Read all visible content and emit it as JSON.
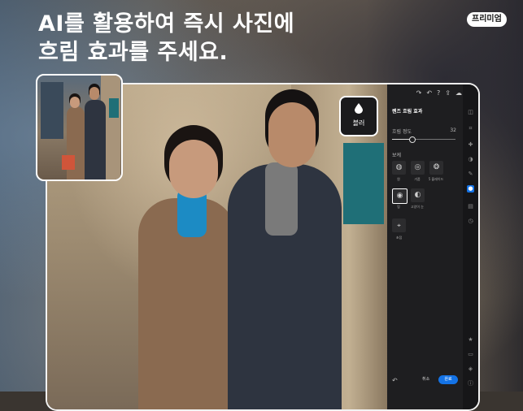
{
  "headline": {
    "line1": "AI를 활용하여 즉시 사진에",
    "line2": "흐림 효과를 주세요."
  },
  "badge": {
    "label": "프리미엄"
  },
  "canvas": {
    "blur_badge": {
      "icon": "water-drop-icon",
      "label": "블러"
    }
  },
  "panel": {
    "top_icons": [
      "redo-icon",
      "undo-icon",
      "help-icon",
      "share-icon",
      "cloud-icon",
      "more-icon"
    ],
    "title": "렌즈 흐림 효과",
    "strength": {
      "label": "흐림 정도",
      "value": "32",
      "fraction": 0.32
    },
    "shape_section_label": "보케",
    "shapes": [
      {
        "icon": "bokeh-circle-icon",
        "label": "원",
        "selected": false
      },
      {
        "icon": "bokeh-bubble-icon",
        "label": "거품",
        "selected": false
      },
      {
        "icon": "bokeh-ring-icon",
        "label": "5 블레이드",
        "selected": false
      },
      {
        "icon": "bokeh-cat-eye-icon",
        "label": "링",
        "selected": true
      },
      {
        "icon": "bokeh-swirl-icon",
        "label": "고양이 눈",
        "selected": false
      }
    ],
    "focus": {
      "icon": "focus-icon",
      "label": "초점"
    },
    "footer": {
      "cancel": "취소",
      "done": "완료"
    }
  },
  "rail_icons": [
    {
      "icon": "edit-icon",
      "active": false
    },
    {
      "icon": "crop-icon",
      "active": false
    },
    {
      "icon": "heal-icon",
      "active": false
    },
    {
      "icon": "masking-icon",
      "active": false
    },
    {
      "icon": "remove-icon",
      "active": false
    },
    {
      "icon": "blur-icon",
      "active": true
    },
    {
      "icon": "presets-icon",
      "active": false
    },
    {
      "icon": "versions-icon",
      "active": false
    },
    {
      "icon": "star-icon",
      "active": false
    },
    {
      "icon": "comment-icon",
      "active": false
    },
    {
      "icon": "tag-icon",
      "active": false
    },
    {
      "icon": "info-icon",
      "active": false
    }
  ],
  "colors": {
    "accent": "#1473e6",
    "panel_bg": "#1e1e20",
    "teal": "#1f6f77"
  }
}
